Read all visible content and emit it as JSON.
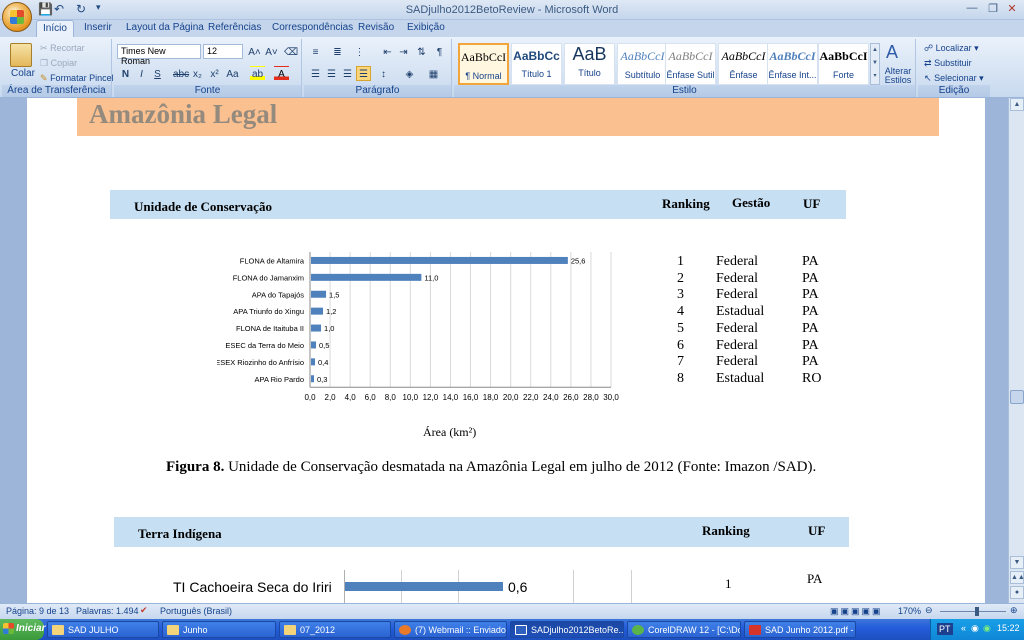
{
  "window": {
    "title": "SADjulho2012BetoReview - Microsoft Word"
  },
  "tabs": [
    "Início",
    "Inserir",
    "Layout da Página",
    "Referências",
    "Correspondências",
    "Revisão",
    "Exibição"
  ],
  "ribbon": {
    "clipboard": {
      "label": "Área de Transferência",
      "paste": "Colar",
      "cut": "Recortar",
      "copy": "Copiar",
      "format_painter": "Formatar Pincel"
    },
    "font": {
      "label": "Fonte",
      "family": "Times New Roman",
      "size": "12"
    },
    "paragraph": {
      "label": "Parágrafo"
    },
    "styles": {
      "label": "Estilo",
      "items": [
        {
          "sample": "AaBbCcI",
          "name": "¶ Normal"
        },
        {
          "sample": "AaBbCc",
          "name": "Título 1"
        },
        {
          "sample": "AaB",
          "name": "Título"
        },
        {
          "sample": "AaBbCcI",
          "name": "Subtítulo"
        },
        {
          "sample": "AaBbCcI",
          "name": "Ênfase Sutil"
        },
        {
          "sample": "AaBbCcI",
          "name": "Ênfase"
        },
        {
          "sample": "AaBbCcI",
          "name": "Ênfase Int..."
        },
        {
          "sample": "AaBbCcI",
          "name": "Forte"
        }
      ],
      "change_styles": "Alterar Estilos"
    },
    "editing": {
      "label": "Edição",
      "find": "Localizar",
      "replace": "Substituir",
      "select": "Selecionar"
    }
  },
  "document": {
    "heading": "Amazônia Legal",
    "uc_table": {
      "col1": "Unidade de Conservação",
      "col2": "Ranking",
      "col3": "Gestão",
      "col4": "UF",
      "rows": [
        [
          "1",
          "Federal",
          "PA"
        ],
        [
          "2",
          "Federal",
          "PA"
        ],
        [
          "3",
          "Federal",
          "PA"
        ],
        [
          "4",
          "Estadual",
          "PA"
        ],
        [
          "5",
          "Federal",
          "PA"
        ],
        [
          "6",
          "Federal",
          "PA"
        ],
        [
          "7",
          "Federal",
          "PA"
        ],
        [
          "8",
          "Estadual",
          "RO"
        ]
      ]
    },
    "caption_bold": "Figura 8.",
    "caption_text": "Unidade de Conservação desmatada na Amazônia Legal em julho de 2012 (Fonte: Imazon /SAD).",
    "ti_table": {
      "col1": "Terra Indígena",
      "col2": "Ranking",
      "col3": "UF",
      "row1": [
        "1",
        "PA"
      ]
    },
    "ti_chart": {
      "label": "TI Cachoeira Seca do Iriri",
      "value_label": "0,6"
    }
  },
  "chart_data": {
    "type": "bar",
    "orientation": "horizontal",
    "categories": [
      "FLONA de Altamira",
      "FLONA do Jamanxim",
      "APA do Tapajós",
      "APA  Triunfo do Xingu",
      "FLONA de Itaituba II",
      "ESEC da Terra do Meio",
      "RESEX Riozinho do Anfrísio",
      "APA  Rio Pardo"
    ],
    "values": [
      25.6,
      11.0,
      1.5,
      1.2,
      1.0,
      0.5,
      0.4,
      0.3
    ],
    "value_labels": [
      "25,6",
      "11,0",
      "1,5",
      "1,2",
      "1,0",
      "0,5",
      "0,4",
      "0,3"
    ],
    "xticks": [
      "0,0",
      "2,0",
      "4,0",
      "6,0",
      "8,0",
      "10,0",
      "12,0",
      "14,0",
      "16,0",
      "18,0",
      "20,0",
      "22,0",
      "24,0",
      "26,0",
      "28,0",
      "30,0"
    ],
    "xlim": [
      0,
      30
    ],
    "xlabel": "Área (km²)",
    "bar_color": "#4f81bd",
    "grid": true
  },
  "status": {
    "page": "Página: 9 de 13",
    "words": "Palavras: 1.494",
    "language": "Português (Brasil)",
    "zoom": "170%"
  },
  "taskbar": {
    "start": "Iniciar",
    "items": [
      "SAD JULHO",
      "Junho",
      "07_2012",
      "(7) Webmail :: Enviados ...",
      "SADjulho2012BetoRe...",
      "CorelDRAW 12 - [C:\\Doc...",
      "SAD Junho 2012.pdf - F..."
    ],
    "lang": "PT",
    "clock": "15:22"
  },
  "colors": {
    "accent": "#15428b",
    "heading_band": "#fac08f",
    "table_band": "#c6dff2",
    "bars": "#4f81bd"
  }
}
